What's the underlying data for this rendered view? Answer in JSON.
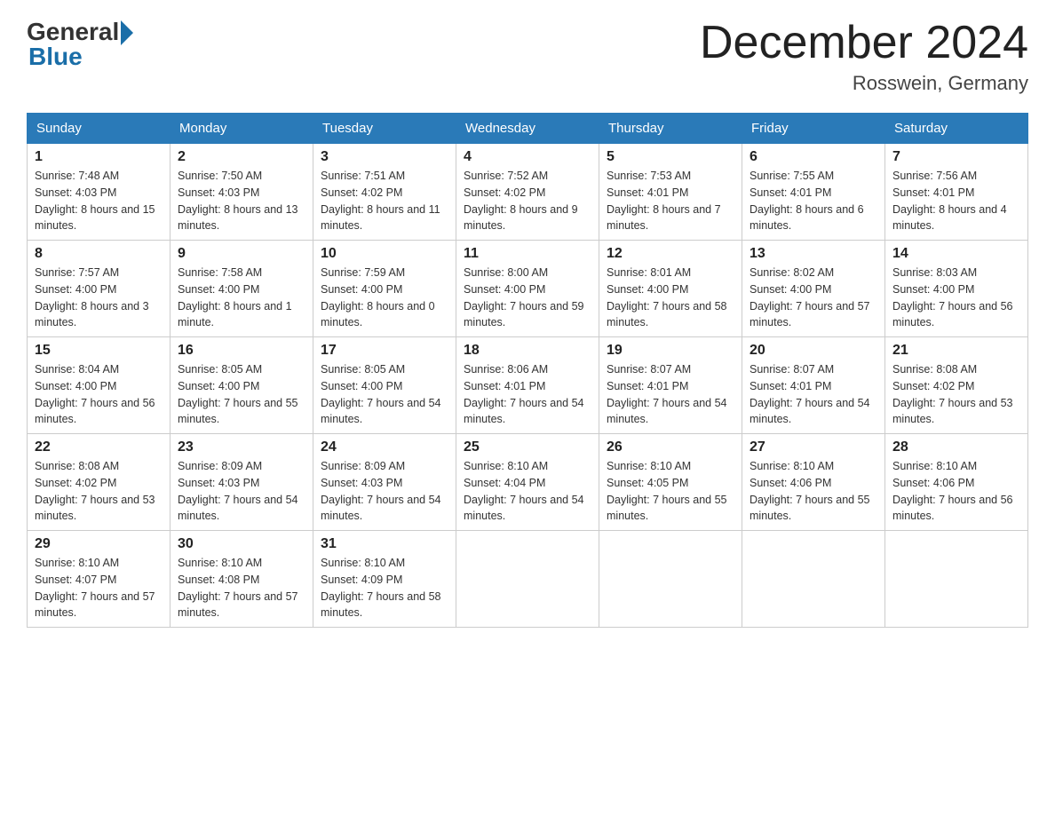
{
  "header": {
    "logo_general": "General",
    "logo_blue": "Blue",
    "title": "December 2024",
    "location": "Rosswein, Germany"
  },
  "weekdays": [
    "Sunday",
    "Monday",
    "Tuesday",
    "Wednesday",
    "Thursday",
    "Friday",
    "Saturday"
  ],
  "weeks": [
    [
      {
        "day": "1",
        "sunrise": "7:48 AM",
        "sunset": "4:03 PM",
        "daylight": "8 hours and 15 minutes."
      },
      {
        "day": "2",
        "sunrise": "7:50 AM",
        "sunset": "4:03 PM",
        "daylight": "8 hours and 13 minutes."
      },
      {
        "day": "3",
        "sunrise": "7:51 AM",
        "sunset": "4:02 PM",
        "daylight": "8 hours and 11 minutes."
      },
      {
        "day": "4",
        "sunrise": "7:52 AM",
        "sunset": "4:02 PM",
        "daylight": "8 hours and 9 minutes."
      },
      {
        "day": "5",
        "sunrise": "7:53 AM",
        "sunset": "4:01 PM",
        "daylight": "8 hours and 7 minutes."
      },
      {
        "day": "6",
        "sunrise": "7:55 AM",
        "sunset": "4:01 PM",
        "daylight": "8 hours and 6 minutes."
      },
      {
        "day": "7",
        "sunrise": "7:56 AM",
        "sunset": "4:01 PM",
        "daylight": "8 hours and 4 minutes."
      }
    ],
    [
      {
        "day": "8",
        "sunrise": "7:57 AM",
        "sunset": "4:00 PM",
        "daylight": "8 hours and 3 minutes."
      },
      {
        "day": "9",
        "sunrise": "7:58 AM",
        "sunset": "4:00 PM",
        "daylight": "8 hours and 1 minute."
      },
      {
        "day": "10",
        "sunrise": "7:59 AM",
        "sunset": "4:00 PM",
        "daylight": "8 hours and 0 minutes."
      },
      {
        "day": "11",
        "sunrise": "8:00 AM",
        "sunset": "4:00 PM",
        "daylight": "7 hours and 59 minutes."
      },
      {
        "day": "12",
        "sunrise": "8:01 AM",
        "sunset": "4:00 PM",
        "daylight": "7 hours and 58 minutes."
      },
      {
        "day": "13",
        "sunrise": "8:02 AM",
        "sunset": "4:00 PM",
        "daylight": "7 hours and 57 minutes."
      },
      {
        "day": "14",
        "sunrise": "8:03 AM",
        "sunset": "4:00 PM",
        "daylight": "7 hours and 56 minutes."
      }
    ],
    [
      {
        "day": "15",
        "sunrise": "8:04 AM",
        "sunset": "4:00 PM",
        "daylight": "7 hours and 56 minutes."
      },
      {
        "day": "16",
        "sunrise": "8:05 AM",
        "sunset": "4:00 PM",
        "daylight": "7 hours and 55 minutes."
      },
      {
        "day": "17",
        "sunrise": "8:05 AM",
        "sunset": "4:00 PM",
        "daylight": "7 hours and 54 minutes."
      },
      {
        "day": "18",
        "sunrise": "8:06 AM",
        "sunset": "4:01 PM",
        "daylight": "7 hours and 54 minutes."
      },
      {
        "day": "19",
        "sunrise": "8:07 AM",
        "sunset": "4:01 PM",
        "daylight": "7 hours and 54 minutes."
      },
      {
        "day": "20",
        "sunrise": "8:07 AM",
        "sunset": "4:01 PM",
        "daylight": "7 hours and 54 minutes."
      },
      {
        "day": "21",
        "sunrise": "8:08 AM",
        "sunset": "4:02 PM",
        "daylight": "7 hours and 53 minutes."
      }
    ],
    [
      {
        "day": "22",
        "sunrise": "8:08 AM",
        "sunset": "4:02 PM",
        "daylight": "7 hours and 53 minutes."
      },
      {
        "day": "23",
        "sunrise": "8:09 AM",
        "sunset": "4:03 PM",
        "daylight": "7 hours and 54 minutes."
      },
      {
        "day": "24",
        "sunrise": "8:09 AM",
        "sunset": "4:03 PM",
        "daylight": "7 hours and 54 minutes."
      },
      {
        "day": "25",
        "sunrise": "8:10 AM",
        "sunset": "4:04 PM",
        "daylight": "7 hours and 54 minutes."
      },
      {
        "day": "26",
        "sunrise": "8:10 AM",
        "sunset": "4:05 PM",
        "daylight": "7 hours and 55 minutes."
      },
      {
        "day": "27",
        "sunrise": "8:10 AM",
        "sunset": "4:06 PM",
        "daylight": "7 hours and 55 minutes."
      },
      {
        "day": "28",
        "sunrise": "8:10 AM",
        "sunset": "4:06 PM",
        "daylight": "7 hours and 56 minutes."
      }
    ],
    [
      {
        "day": "29",
        "sunrise": "8:10 AM",
        "sunset": "4:07 PM",
        "daylight": "7 hours and 57 minutes."
      },
      {
        "day": "30",
        "sunrise": "8:10 AM",
        "sunset": "4:08 PM",
        "daylight": "7 hours and 57 minutes."
      },
      {
        "day": "31",
        "sunrise": "8:10 AM",
        "sunset": "4:09 PM",
        "daylight": "7 hours and 58 minutes."
      },
      null,
      null,
      null,
      null
    ]
  ]
}
